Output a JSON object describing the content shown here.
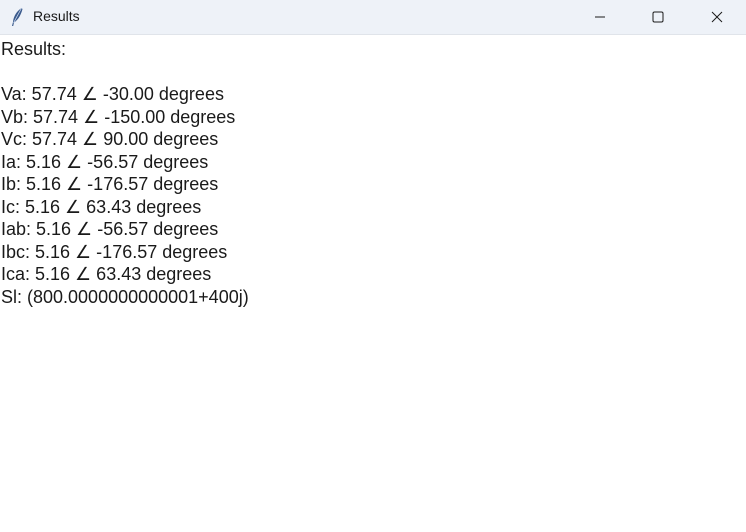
{
  "window": {
    "title": "Results",
    "icon": "feather-icon",
    "controls": {
      "minimize_icon": "minimize-icon",
      "maximize_icon": "maximize-icon",
      "close_icon": "close-icon"
    }
  },
  "results": {
    "heading": "Results:",
    "lines": [
      "Va: 57.74 ∠ -30.00 degrees",
      "Vb: 57.74 ∠ -150.00 degrees",
      "Vc: 57.74 ∠ 90.00 degrees",
      "Ia: 5.16 ∠ -56.57 degrees",
      "Ib: 5.16 ∠ -176.57 degrees",
      "Ic: 5.16 ∠ 63.43 degrees",
      "Iab: 5.16 ∠ -56.57 degrees",
      "Ibc: 5.16 ∠ -176.57 degrees",
      "Ica: 5.16 ∠ 63.43 degrees",
      "Sl: (800.0000000000001+400j)"
    ]
  }
}
